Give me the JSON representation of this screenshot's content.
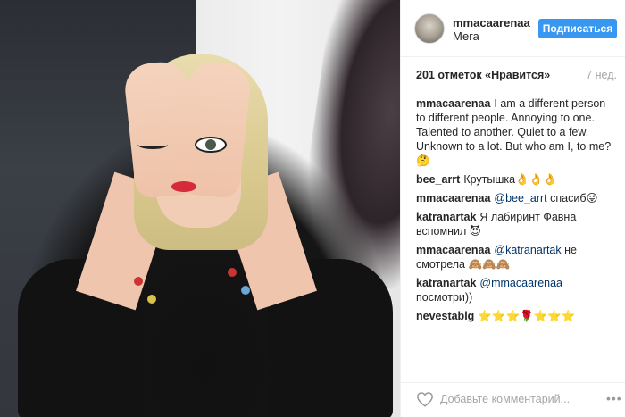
{
  "post": {
    "username": "mmacaarenaa",
    "location": "Мега",
    "follow_label": "Подписаться",
    "likes": "201 отметок «Нравится»",
    "time": "7 нед."
  },
  "comments": [
    {
      "author": "mmacaarenaa",
      "text": "I am a different person to different people. Annoying to one. Talented to another. Quiet to a few. Unknown to a lot. But who am I, to me?",
      "emoji": "🤔"
    },
    {
      "author": "bee_arrt",
      "text": "Крутышка",
      "emoji": "👌👌👌"
    },
    {
      "author": "mmacaarenaa",
      "mention": "@bee_arrt",
      "text": "спасиб",
      "emoji": "😜"
    },
    {
      "author": "katranartak",
      "text": "Я лабиринт Фавна вспомнил",
      "emoji": "😈"
    },
    {
      "author": "mmacaarenaa",
      "mention": "@katranartak",
      "text": "не смотрела",
      "emoji": "🙈🙈🙈"
    },
    {
      "author": "katranartak",
      "mention": "@mmacaarenaa",
      "text": "посмотри))",
      "emoji": ""
    },
    {
      "author": "nevestablg",
      "text": "",
      "emoji": "⭐⭐⭐🌹⭐⭐⭐"
    }
  ],
  "footer": {
    "comment_placeholder": "Добавьте комментарий...",
    "heart_icon": "heart-icon",
    "more_icon": "more-options-icon"
  },
  "colors": {
    "accent": "#3897f0",
    "mention": "#003569",
    "muted": "#a6a6a6"
  }
}
